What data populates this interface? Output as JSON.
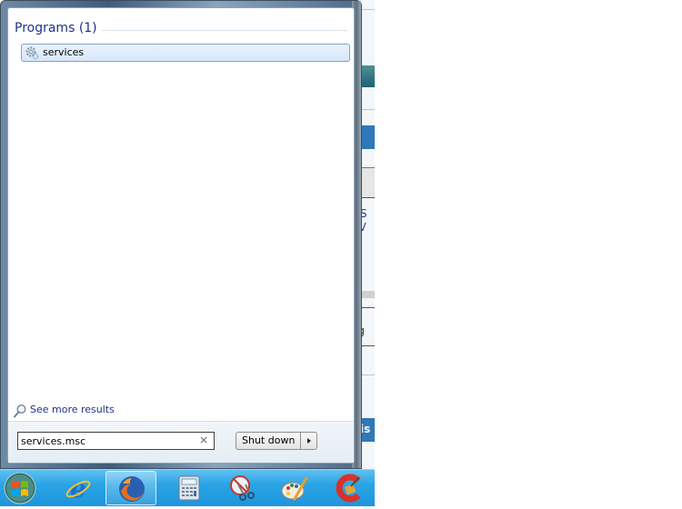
{
  "start_menu": {
    "section_title": "Programs (1)",
    "results": [
      {
        "label": "services",
        "icon": "services-gear-icon"
      }
    ],
    "see_more_label": "See more results",
    "search": {
      "value": "services.msc",
      "clear_label": "×"
    },
    "shutdown_label": "Shut down"
  },
  "background_window": {
    "fragment_1": ">S",
    "fragment_2": "t V",
    "fragment_3": "ag",
    "fragment_4": "is",
    "fragment_5": "g"
  },
  "taskbar": {
    "items": [
      {
        "name": "internet-explorer",
        "icon": "internet-explorer-icon"
      },
      {
        "name": "firefox",
        "icon": "firefox-icon",
        "active": true
      },
      {
        "name": "calculator",
        "icon": "calculator-icon"
      },
      {
        "name": "snipping-tool",
        "icon": "snipping-tool-icon"
      },
      {
        "name": "paint",
        "icon": "paint-icon"
      },
      {
        "name": "ccleaner",
        "icon": "ccleaner-icon"
      }
    ]
  },
  "colors": {
    "link_blue": "#1e3287",
    "taskbar_blue": "#2aa4e6",
    "selection_border": "#7da2ce"
  }
}
